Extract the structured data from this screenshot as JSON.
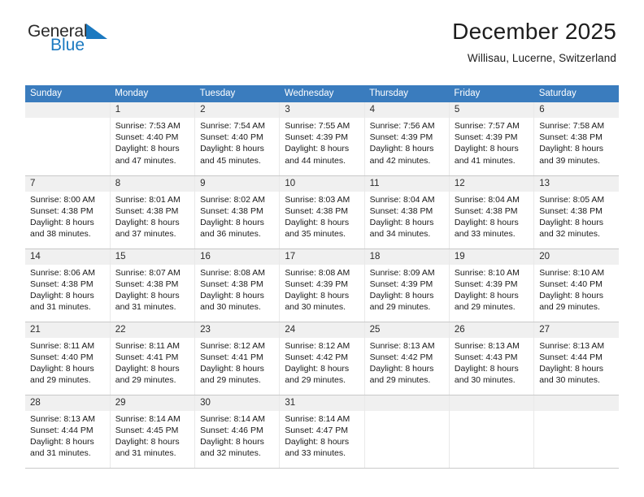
{
  "brand": {
    "name_part1": "General",
    "name_part2": "Blue",
    "triangle_icon": "blue-triangle-icon",
    "accent_color": "#1b79c0"
  },
  "header": {
    "title": "December 2025",
    "subtitle": "Willisau, Lucerne, Switzerland"
  },
  "theme": {
    "header_row_bg": "#3a7cbe",
    "daynum_bg": "#f0f0f0",
    "grid_line": "#c9c9c9",
    "text": "#1a1a1a"
  },
  "weekday_headers": [
    "Sunday",
    "Monday",
    "Tuesday",
    "Wednesday",
    "Thursday",
    "Friday",
    "Saturday"
  ],
  "labels": {
    "sunrise_prefix": "Sunrise:",
    "sunset_prefix": "Sunset:",
    "daylight_prefix": "Daylight:"
  },
  "weeks": [
    [
      {
        "day": "",
        "blank": true
      },
      {
        "day": "1",
        "sunrise": "Sunrise: 7:53 AM",
        "sunset": "Sunset: 4:40 PM",
        "daylight1": "Daylight: 8 hours",
        "daylight2": "and 47 minutes."
      },
      {
        "day": "2",
        "sunrise": "Sunrise: 7:54 AM",
        "sunset": "Sunset: 4:40 PM",
        "daylight1": "Daylight: 8 hours",
        "daylight2": "and 45 minutes."
      },
      {
        "day": "3",
        "sunrise": "Sunrise: 7:55 AM",
        "sunset": "Sunset: 4:39 PM",
        "daylight1": "Daylight: 8 hours",
        "daylight2": "and 44 minutes."
      },
      {
        "day": "4",
        "sunrise": "Sunrise: 7:56 AM",
        "sunset": "Sunset: 4:39 PM",
        "daylight1": "Daylight: 8 hours",
        "daylight2": "and 42 minutes."
      },
      {
        "day": "5",
        "sunrise": "Sunrise: 7:57 AM",
        "sunset": "Sunset: 4:39 PM",
        "daylight1": "Daylight: 8 hours",
        "daylight2": "and 41 minutes."
      },
      {
        "day": "6",
        "sunrise": "Sunrise: 7:58 AM",
        "sunset": "Sunset: 4:38 PM",
        "daylight1": "Daylight: 8 hours",
        "daylight2": "and 39 minutes."
      }
    ],
    [
      {
        "day": "7",
        "sunrise": "Sunrise: 8:00 AM",
        "sunset": "Sunset: 4:38 PM",
        "daylight1": "Daylight: 8 hours",
        "daylight2": "and 38 minutes."
      },
      {
        "day": "8",
        "sunrise": "Sunrise: 8:01 AM",
        "sunset": "Sunset: 4:38 PM",
        "daylight1": "Daylight: 8 hours",
        "daylight2": "and 37 minutes."
      },
      {
        "day": "9",
        "sunrise": "Sunrise: 8:02 AM",
        "sunset": "Sunset: 4:38 PM",
        "daylight1": "Daylight: 8 hours",
        "daylight2": "and 36 minutes."
      },
      {
        "day": "10",
        "sunrise": "Sunrise: 8:03 AM",
        "sunset": "Sunset: 4:38 PM",
        "daylight1": "Daylight: 8 hours",
        "daylight2": "and 35 minutes."
      },
      {
        "day": "11",
        "sunrise": "Sunrise: 8:04 AM",
        "sunset": "Sunset: 4:38 PM",
        "daylight1": "Daylight: 8 hours",
        "daylight2": "and 34 minutes."
      },
      {
        "day": "12",
        "sunrise": "Sunrise: 8:04 AM",
        "sunset": "Sunset: 4:38 PM",
        "daylight1": "Daylight: 8 hours",
        "daylight2": "and 33 minutes."
      },
      {
        "day": "13",
        "sunrise": "Sunrise: 8:05 AM",
        "sunset": "Sunset: 4:38 PM",
        "daylight1": "Daylight: 8 hours",
        "daylight2": "and 32 minutes."
      }
    ],
    [
      {
        "day": "14",
        "sunrise": "Sunrise: 8:06 AM",
        "sunset": "Sunset: 4:38 PM",
        "daylight1": "Daylight: 8 hours",
        "daylight2": "and 31 minutes."
      },
      {
        "day": "15",
        "sunrise": "Sunrise: 8:07 AM",
        "sunset": "Sunset: 4:38 PM",
        "daylight1": "Daylight: 8 hours",
        "daylight2": "and 31 minutes."
      },
      {
        "day": "16",
        "sunrise": "Sunrise: 8:08 AM",
        "sunset": "Sunset: 4:38 PM",
        "daylight1": "Daylight: 8 hours",
        "daylight2": "and 30 minutes."
      },
      {
        "day": "17",
        "sunrise": "Sunrise: 8:08 AM",
        "sunset": "Sunset: 4:39 PM",
        "daylight1": "Daylight: 8 hours",
        "daylight2": "and 30 minutes."
      },
      {
        "day": "18",
        "sunrise": "Sunrise: 8:09 AM",
        "sunset": "Sunset: 4:39 PM",
        "daylight1": "Daylight: 8 hours",
        "daylight2": "and 29 minutes."
      },
      {
        "day": "19",
        "sunrise": "Sunrise: 8:10 AM",
        "sunset": "Sunset: 4:39 PM",
        "daylight1": "Daylight: 8 hours",
        "daylight2": "and 29 minutes."
      },
      {
        "day": "20",
        "sunrise": "Sunrise: 8:10 AM",
        "sunset": "Sunset: 4:40 PM",
        "daylight1": "Daylight: 8 hours",
        "daylight2": "and 29 minutes."
      }
    ],
    [
      {
        "day": "21",
        "sunrise": "Sunrise: 8:11 AM",
        "sunset": "Sunset: 4:40 PM",
        "daylight1": "Daylight: 8 hours",
        "daylight2": "and 29 minutes."
      },
      {
        "day": "22",
        "sunrise": "Sunrise: 8:11 AM",
        "sunset": "Sunset: 4:41 PM",
        "daylight1": "Daylight: 8 hours",
        "daylight2": "and 29 minutes."
      },
      {
        "day": "23",
        "sunrise": "Sunrise: 8:12 AM",
        "sunset": "Sunset: 4:41 PM",
        "daylight1": "Daylight: 8 hours",
        "daylight2": "and 29 minutes."
      },
      {
        "day": "24",
        "sunrise": "Sunrise: 8:12 AM",
        "sunset": "Sunset: 4:42 PM",
        "daylight1": "Daylight: 8 hours",
        "daylight2": "and 29 minutes."
      },
      {
        "day": "25",
        "sunrise": "Sunrise: 8:13 AM",
        "sunset": "Sunset: 4:42 PM",
        "daylight1": "Daylight: 8 hours",
        "daylight2": "and 29 minutes."
      },
      {
        "day": "26",
        "sunrise": "Sunrise: 8:13 AM",
        "sunset": "Sunset: 4:43 PM",
        "daylight1": "Daylight: 8 hours",
        "daylight2": "and 30 minutes."
      },
      {
        "day": "27",
        "sunrise": "Sunrise: 8:13 AM",
        "sunset": "Sunset: 4:44 PM",
        "daylight1": "Daylight: 8 hours",
        "daylight2": "and 30 minutes."
      }
    ],
    [
      {
        "day": "28",
        "sunrise": "Sunrise: 8:13 AM",
        "sunset": "Sunset: 4:44 PM",
        "daylight1": "Daylight: 8 hours",
        "daylight2": "and 31 minutes."
      },
      {
        "day": "29",
        "sunrise": "Sunrise: 8:14 AM",
        "sunset": "Sunset: 4:45 PM",
        "daylight1": "Daylight: 8 hours",
        "daylight2": "and 31 minutes."
      },
      {
        "day": "30",
        "sunrise": "Sunrise: 8:14 AM",
        "sunset": "Sunset: 4:46 PM",
        "daylight1": "Daylight: 8 hours",
        "daylight2": "and 32 minutes."
      },
      {
        "day": "31",
        "sunrise": "Sunrise: 8:14 AM",
        "sunset": "Sunset: 4:47 PM",
        "daylight1": "Daylight: 8 hours",
        "daylight2": "and 33 minutes."
      },
      {
        "day": "",
        "empty": true
      },
      {
        "day": "",
        "empty": true
      },
      {
        "day": "",
        "empty": true
      }
    ]
  ]
}
